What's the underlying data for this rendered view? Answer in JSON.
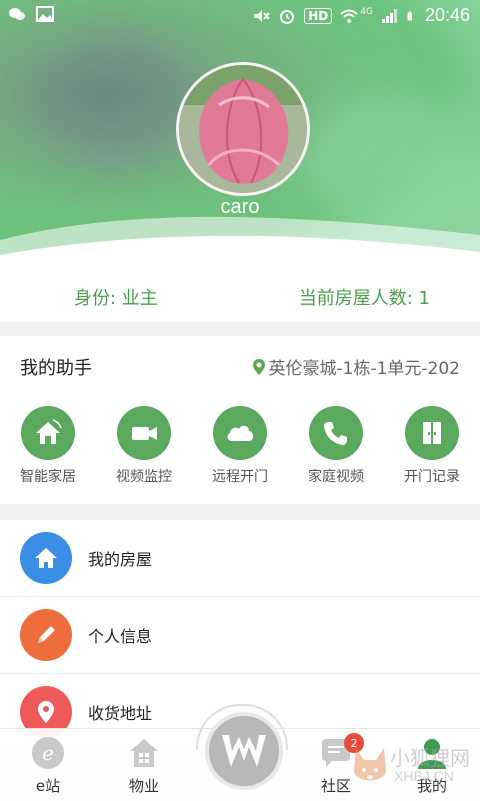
{
  "status_bar": {
    "time": "20:46",
    "hd_label": "HD",
    "network": "4G"
  },
  "profile": {
    "username": "caro"
  },
  "info": {
    "identity": "身份: 业主",
    "house_count": "当前房屋人数: 1"
  },
  "assistant": {
    "title": "我的助手",
    "location": "英伦豪城-1栋-1单元-202",
    "tools": [
      {
        "label": "智能家居",
        "icon": "smart-home-icon"
      },
      {
        "label": "视频监控",
        "icon": "video-camera-icon"
      },
      {
        "label": "远程开门",
        "icon": "cloud-icon"
      },
      {
        "label": "家庭视频",
        "icon": "phone-icon"
      },
      {
        "label": "开门记录",
        "icon": "door-icon"
      }
    ]
  },
  "menu": {
    "items": [
      {
        "label": "我的房屋",
        "icon": "house-icon",
        "color": "#3a8ee6"
      },
      {
        "label": "个人信息",
        "icon": "pencil-icon",
        "color": "#ee6d3a"
      },
      {
        "label": "收货地址",
        "icon": "location-pin-icon",
        "color": "#ee5a5a"
      }
    ]
  },
  "bottom_nav": {
    "items": [
      {
        "label": "e站",
        "icon": "e-station-icon"
      },
      {
        "label": "物业",
        "icon": "property-icon"
      },
      {
        "label": "社区",
        "icon": "community-chat-icon",
        "badge": "2"
      },
      {
        "label": "我的",
        "icon": "profile-icon",
        "active": true
      }
    ]
  },
  "watermark": {
    "text": "小狐狸网",
    "sub": "XHBJ.CN"
  },
  "colors": {
    "accent": "#5aa95d",
    "info_text": "#4c9e4c"
  }
}
